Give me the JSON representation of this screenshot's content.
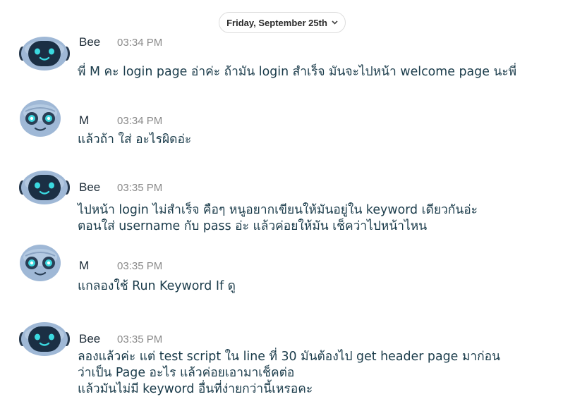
{
  "date_divider": {
    "label": "Friday, September 25th",
    "icon": "chevron-down-icon"
  },
  "messages": [
    {
      "sender": "Bee",
      "time": "03:34 PM",
      "avatar": "bee-robot-avatar",
      "lines": [
        "พี่ M คะ login page อ่าค่ะ ถ้ามัน login สำเร็จ มันจะไปหน้า welcome page นะพี่"
      ]
    },
    {
      "sender": "M",
      "time": "03:34 PM",
      "avatar": "m-robot-avatar",
      "lines": [
        "แล้วถ้า ใส่ อะไรผิดอ่ะ"
      ]
    },
    {
      "sender": "Bee",
      "time": "03:35 PM",
      "avatar": "bee-robot-avatar",
      "lines": [
        "ไปหน้า login ไม่สำเร็จ คือๆ หนูอยากเขียนให้มันอยู่ใน keyword เดียวกันอ่ะ",
        "ตอนใส่ username กับ pass อ่ะ แล้วค่อยให้มัน เช็คว่าไปหน้าไหน"
      ]
    },
    {
      "sender": "M",
      "time": "03:35 PM",
      "avatar": "m-robot-avatar",
      "lines": [
        "แกลองใช้ Run Keyword If ดู"
      ]
    },
    {
      "sender": "Bee",
      "time": "03:35 PM",
      "avatar": "bee-robot-avatar",
      "lines": [
        "ลองแล้วค่ะ แต่ test script ใน line ที่ 30 มันต้องไป get header page มาก่อน",
        "ว่าเป็น Page อะไร แล้วค่อยเอามาเช็คต่อ",
        "แล้วมันไม่มี keyword อื่นที่ง่ายกว่านี้เหรอคะ"
      ]
    }
  ]
}
